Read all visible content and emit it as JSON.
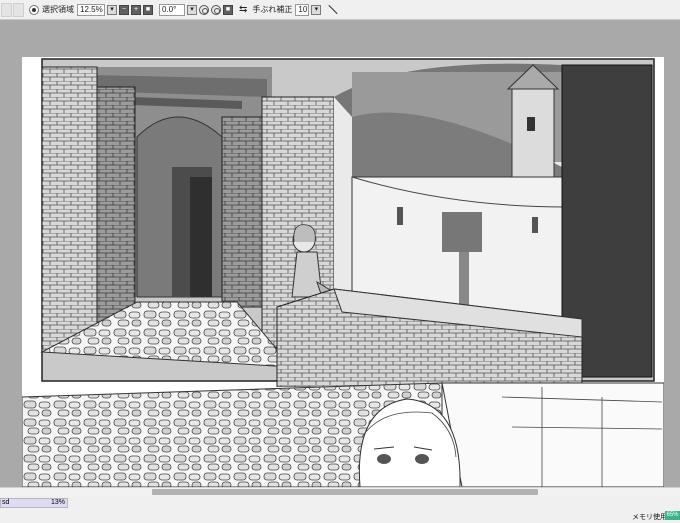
{
  "toolbar": {
    "selection_label": "選択領域",
    "zoom_value": "12.5%",
    "rotation_value": "0.0°",
    "stabilizer_label": "手ぶれ補正",
    "stabilizer_value": "10"
  },
  "document": {
    "file_name": "sd",
    "progress_percent": "13%"
  },
  "status": {
    "memory_label": "メモリ使用量",
    "memory_value": "65%"
  },
  "colors": {
    "toolbar_bg": "#f0f0f0",
    "workspace_bg": "#a9a9a9",
    "file_bar_bg": "#dedcf5",
    "memory_badge": "#3ab28c"
  }
}
